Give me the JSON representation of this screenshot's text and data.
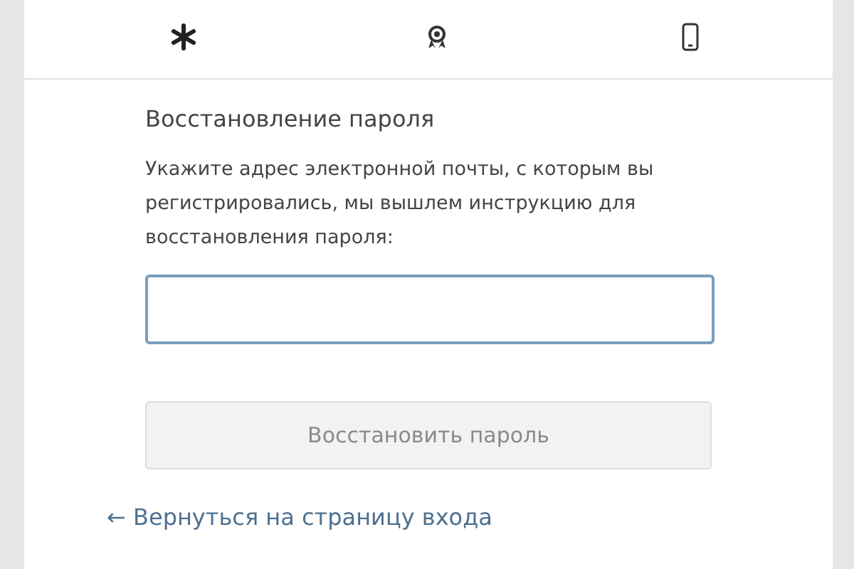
{
  "title": "Восстановление пароля",
  "description": "Укажите адрес электронной почты, с которым вы регистрировались, мы вышлем инструкцию для восстановления пароля:",
  "email_field": {
    "focused": true
  },
  "submit_button": {
    "label": "Восстановить пароль",
    "disabled": true
  },
  "back_link": "← Вернуться на страницу входа"
}
